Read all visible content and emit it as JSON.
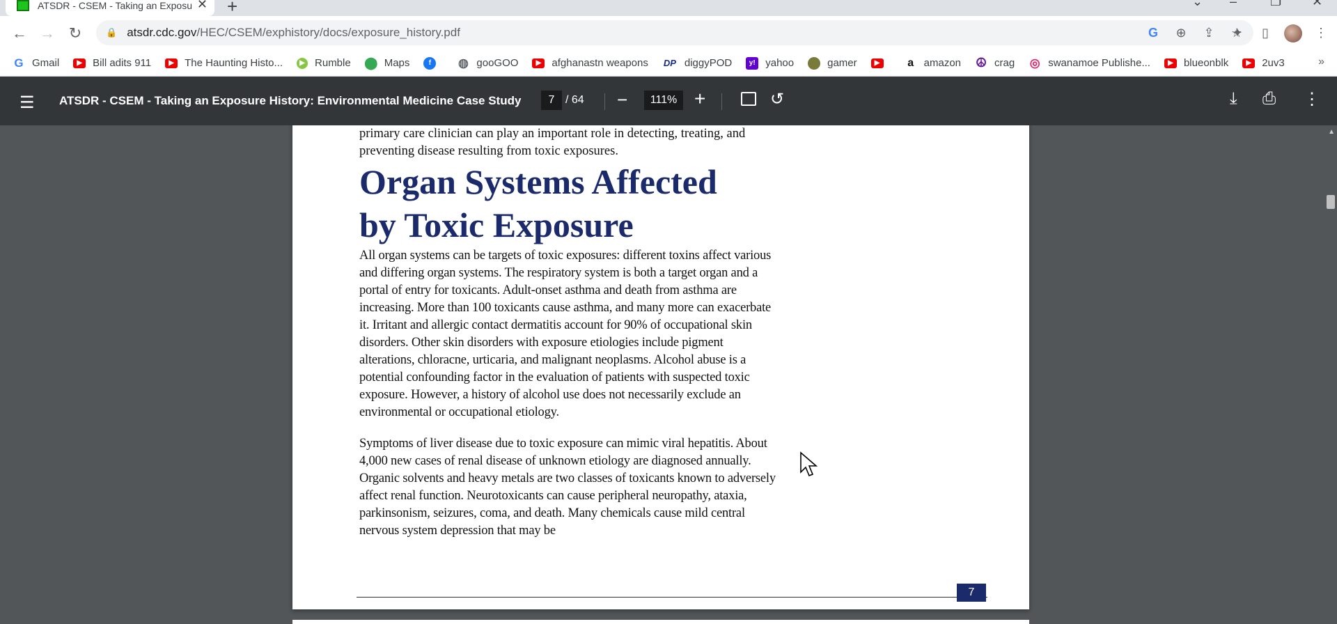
{
  "browser": {
    "tab_title": "ATSDR - CSEM - Taking an Exposure History: Environmental Medicine Case Study",
    "new_tab": "+",
    "url_host": "atsdr.cdc.gov",
    "url_path": "/HEC/CSEM/exphistory/docs/exposure_history.pdf"
  },
  "bookmarks": [
    {
      "label": "Gmail",
      "icon": "google-icon"
    },
    {
      "label": "Bill adits 911",
      "icon": "youtube-icon"
    },
    {
      "label": "The Haunting Histo...",
      "icon": "youtube-icon"
    },
    {
      "label": "Rumble",
      "icon": "rumble-icon"
    },
    {
      "label": "Maps",
      "icon": "maps-icon"
    },
    {
      "label": "",
      "icon": "facebook-icon"
    },
    {
      "label": "gooGOO",
      "icon": "globe-icon"
    },
    {
      "label": "afghanastn weapons",
      "icon": "youtube-icon"
    },
    {
      "label": "diggyPOD",
      "icon": "dp-icon"
    },
    {
      "label": "yahoo",
      "icon": "yahoo-icon"
    },
    {
      "label": "gamer",
      "icon": "gamer-icon"
    },
    {
      "label": "",
      "icon": "youtube-icon"
    },
    {
      "label": "amazon",
      "icon": "amazon-icon"
    },
    {
      "label": "crag",
      "icon": "peace-icon"
    },
    {
      "label": "swanamoe Publishe...",
      "icon": "swan-icon"
    },
    {
      "label": "blueonblk",
      "icon": "youtube-icon"
    },
    {
      "label": "2uv3",
      "icon": "youtube-icon"
    }
  ],
  "pdf": {
    "title": "ATSDR - CSEM - Taking an Exposure History: Environmental Medicine Case Study",
    "current_page": "7",
    "total_pages": "/ 64",
    "zoom": "111%"
  },
  "document": {
    "intro": "primary care clinician can play an important role in detecting, treating, and preventing disease resulting from toxic exposures.",
    "heading_line1": "Organ Systems Affected",
    "heading_line2": "by Toxic Exposure",
    "paragraph1": "All organ systems can be targets of toxic exposures: different toxins affect various and differing organ systems. The respiratory system is both a target organ and a portal of entry for toxicants. Adult-onset asthma and death from asthma are increasing. More than 100 toxicants cause asthma, and many more can exacerbate it. Irritant and allergic contact dermatitis account for 90% of occupational skin disorders. Other skin disorders with exposure etiologies include pigment alterations, chloracne, urticaria, and malignant neoplasms. Alcohol abuse is a potential confounding factor in the evaluation of patients with suspected toxic exposure. However, a history of alcohol use does not necessarily exclude an environmental or occupational etiology.",
    "paragraph2": "Symptoms of liver disease due to toxic exposure can mimic viral hepatitis. About 4,000 new cases of renal disease of unknown etiology are diagnosed annually. Organic solvents and heavy metals are two classes of toxicants known to adversely affect renal function. Neurotoxicants can cause peripheral neuropathy, ataxia, parkinsonism, seizures, coma, and death. Many chemicals cause mild central nervous system depression that may be",
    "page_number": "7"
  }
}
